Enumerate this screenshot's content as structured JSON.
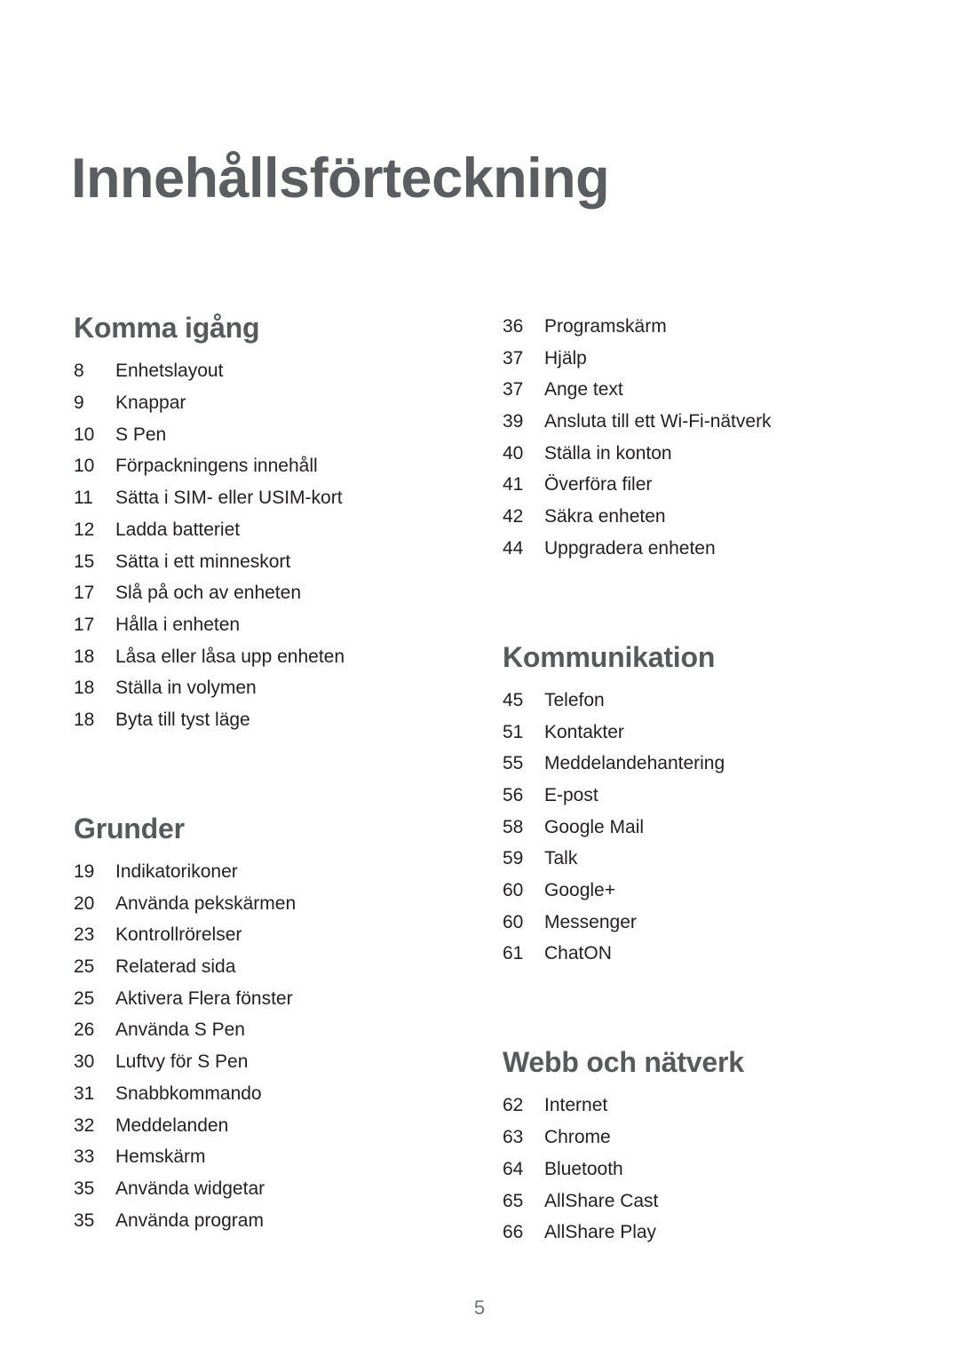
{
  "document": {
    "title": "Innehållsförteckning",
    "folio": "5"
  },
  "colors": {
    "title": "#5c5d60",
    "heading": "#58595b",
    "entry": "#231f20",
    "folio": "#6d7478",
    "background": "#ffffff"
  },
  "columns": [
    {
      "name": "left",
      "sections": [
        {
          "heading": "Komma igång",
          "entries": [
            {
              "page": "8",
              "label": "Enhetslayout"
            },
            {
              "page": "9",
              "label": "Knappar"
            },
            {
              "page": "10",
              "label": "S Pen"
            },
            {
              "page": "10",
              "label": "Förpackningens innehåll"
            },
            {
              "page": "11",
              "label": "Sätta i SIM- eller USIM-kort"
            },
            {
              "page": "12",
              "label": "Ladda batteriet"
            },
            {
              "page": "15",
              "label": "Sätta i ett minneskort"
            },
            {
              "page": "17",
              "label": "Slå på och av enheten"
            },
            {
              "page": "17",
              "label": "Hålla i enheten"
            },
            {
              "page": "18",
              "label": "Låsa eller låsa upp enheten"
            },
            {
              "page": "18",
              "label": "Ställa in volymen"
            },
            {
              "page": "18",
              "label": "Byta till tyst läge"
            }
          ]
        },
        {
          "heading": "Grunder",
          "entries": [
            {
              "page": "19",
              "label": "Indikatorikoner"
            },
            {
              "page": "20",
              "label": "Använda pekskärmen"
            },
            {
              "page": "23",
              "label": "Kontrollrörelser"
            },
            {
              "page": "25",
              "label": "Relaterad sida"
            },
            {
              "page": "25",
              "label": "Aktivera Flera fönster"
            },
            {
              "page": "26",
              "label": "Använda S Pen"
            },
            {
              "page": "30",
              "label": "Luftvy för S Pen"
            },
            {
              "page": "31",
              "label": "Snabbkommando"
            },
            {
              "page": "32",
              "label": "Meddelanden"
            },
            {
              "page": "33",
              "label": "Hemskärm"
            },
            {
              "page": "35",
              "label": "Använda widgetar"
            },
            {
              "page": "35",
              "label": "Använda program"
            }
          ]
        }
      ]
    },
    {
      "name": "right",
      "sections": [
        {
          "heading": "",
          "entries": [
            {
              "page": "36",
              "label": "Programskärm"
            },
            {
              "page": "37",
              "label": "Hjälp"
            },
            {
              "page": "37",
              "label": "Ange text"
            },
            {
              "page": "39",
              "label": "Ansluta till ett Wi-Fi-nätverk"
            },
            {
              "page": "40",
              "label": "Ställa in konton"
            },
            {
              "page": "41",
              "label": "Överföra filer"
            },
            {
              "page": "42",
              "label": "Säkra enheten"
            },
            {
              "page": "44",
              "label": "Uppgradera enheten"
            }
          ]
        },
        {
          "heading": "Kommunikation",
          "entries": [
            {
              "page": "45",
              "label": "Telefon"
            },
            {
              "page": "51",
              "label": "Kontakter"
            },
            {
              "page": "55",
              "label": "Meddelandehantering"
            },
            {
              "page": "56",
              "label": "E-post"
            },
            {
              "page": "58",
              "label": "Google Mail"
            },
            {
              "page": "59",
              "label": "Talk"
            },
            {
              "page": "60",
              "label": "Google+"
            },
            {
              "page": "60",
              "label": "Messenger"
            },
            {
              "page": "61",
              "label": "ChatON"
            }
          ]
        },
        {
          "heading": "Webb och nätverk",
          "entries": [
            {
              "page": "62",
              "label": "Internet"
            },
            {
              "page": "63",
              "label": "Chrome"
            },
            {
              "page": "64",
              "label": "Bluetooth"
            },
            {
              "page": "65",
              "label": "AllShare Cast"
            },
            {
              "page": "66",
              "label": "AllShare Play"
            }
          ]
        }
      ]
    }
  ]
}
